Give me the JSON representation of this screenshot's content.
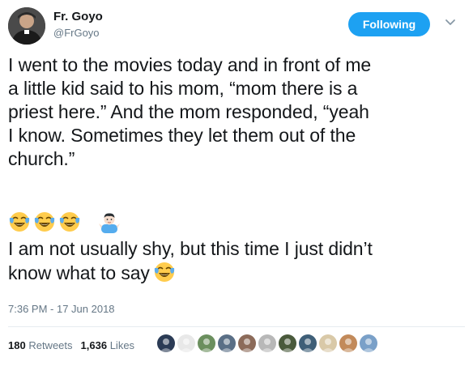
{
  "author": {
    "name": "Fr. Goyo",
    "handle": "@FrGoyo"
  },
  "follow_button": {
    "label": "Following"
  },
  "tweet": {
    "text": "I went to the movies today and in front of me\na little kid said to his mom, “mom there is a\npriest here.” And the mom responded, “yeah\nI know. Sometimes they let them out of the\nchurch.”",
    "emoji_row": [
      "face-with-tears-of-joy",
      "face-with-tears-of-joy",
      "face-with-tears-of-joy",
      "man-shrugging"
    ],
    "line2": "I am not usually shy, but this time I just didn’t\nknow what to say",
    "line2_emoji": "face-with-tears-of-joy"
  },
  "timestamp": "7:36 PM - 17 Jun 2018",
  "stats": {
    "retweets_count": "180",
    "retweets_label": "Retweets",
    "likes_count": "1,636",
    "likes_label": "Likes"
  },
  "likers": [
    {
      "icon": "avatar-icon",
      "color": "#2b3b55"
    },
    {
      "icon": "avatar-icon",
      "color": "#e8e8e8"
    },
    {
      "icon": "avatar-icon",
      "color": "#6b8f5e"
    },
    {
      "icon": "avatar-icon",
      "color": "#5a6f86"
    },
    {
      "icon": "avatar-icon",
      "color": "#8c6b5a"
    },
    {
      "icon": "avatar-icon",
      "color": "#b8b8b8"
    },
    {
      "icon": "avatar-icon",
      "color": "#4a5a3c"
    },
    {
      "icon": "avatar-icon",
      "color": "#3f5f78"
    },
    {
      "icon": "avatar-icon",
      "color": "#d9c9a8"
    },
    {
      "icon": "avatar-icon",
      "color": "#c28a5a"
    },
    {
      "icon": "avatar-icon",
      "color": "#7aa0c8"
    }
  ],
  "colors": {
    "accent": "#1da1f2",
    "secondary_text": "#657786",
    "primary_text": "#14171a"
  }
}
